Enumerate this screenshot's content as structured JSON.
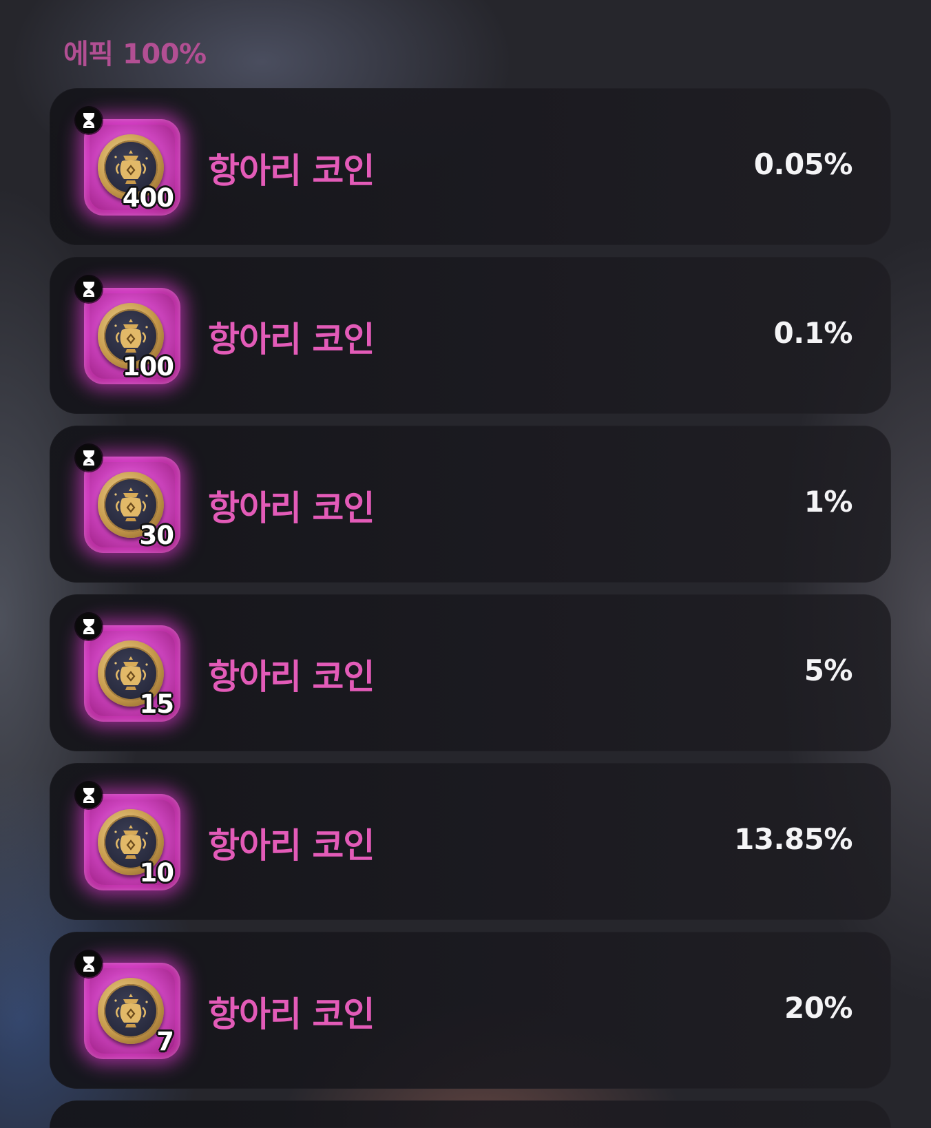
{
  "section": {
    "title": "에픽 100%"
  },
  "items": [
    {
      "name": "항아리 코인",
      "quantity": "400",
      "probability": "0.05%",
      "icon": "jar-coin-icon",
      "badge_icon": "hourglass-icon"
    },
    {
      "name": "항아리 코인",
      "quantity": "100",
      "probability": "0.1%",
      "icon": "jar-coin-icon",
      "badge_icon": "hourglass-icon"
    },
    {
      "name": "항아리 코인",
      "quantity": "30",
      "probability": "1%",
      "icon": "jar-coin-icon",
      "badge_icon": "hourglass-icon"
    },
    {
      "name": "항아리 코인",
      "quantity": "15",
      "probability": "5%",
      "icon": "jar-coin-icon",
      "badge_icon": "hourglass-icon"
    },
    {
      "name": "항아리 코인",
      "quantity": "10",
      "probability": "13.85%",
      "icon": "jar-coin-icon",
      "badge_icon": "hourglass-icon"
    },
    {
      "name": "항아리 코인",
      "quantity": "7",
      "probability": "20%",
      "icon": "jar-coin-icon",
      "badge_icon": "hourglass-icon"
    }
  ],
  "colors": {
    "item_name": "#e35bb8",
    "section_title": "#b24f93",
    "probability": "#f4f4f6",
    "tile_glow": "#d53bc7",
    "coin_gold": "#c79a4c"
  }
}
